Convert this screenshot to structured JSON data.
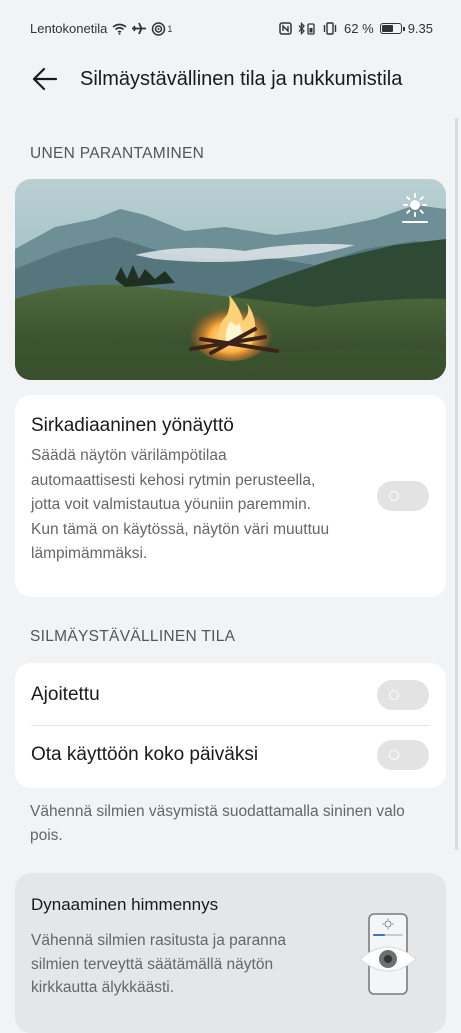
{
  "status": {
    "carrier": "Lentokonetila",
    "hotspot_count": "1",
    "battery_percent": "62 %",
    "time": "9.35",
    "battery_level": 0.62
  },
  "header": {
    "back_icon": "arrow-left-icon",
    "title": "Silmäystävällinen tila ja nukkumistila"
  },
  "sleep_section": {
    "header": "UNEN PARANTAMINEN",
    "hero_icon": "brightness-icon"
  },
  "circadian": {
    "title": "Sirkadiaaninen yönäyttö",
    "description": "Säädä näytön värilämpötilaa automaattisesti kehosi rytmin perusteella, jotta voit valmistautua yöuniin paremmin. Kun tämä on käytössä, näytön väri muuttuu lämpimämmäksi.",
    "enabled": false
  },
  "eye_section": {
    "header": "SILMÄYSTÄVÄLLINEN TILA",
    "rows": [
      {
        "label": "Ajoitettu",
        "enabled": false
      },
      {
        "label": "Ota käyttöön koko päiväksi",
        "enabled": false
      }
    ],
    "hint": "Vähennä silmien väsymistä suodattamalla sininen valo pois."
  },
  "dynamic_dimming": {
    "title": "Dynaaminen himmennys",
    "description": "Vähennä silmien rasitusta ja paranna silmien terveyttä säätämällä näytön kirkkautta älykkäästi.",
    "illustration_icon": "phone-eye-icon"
  }
}
